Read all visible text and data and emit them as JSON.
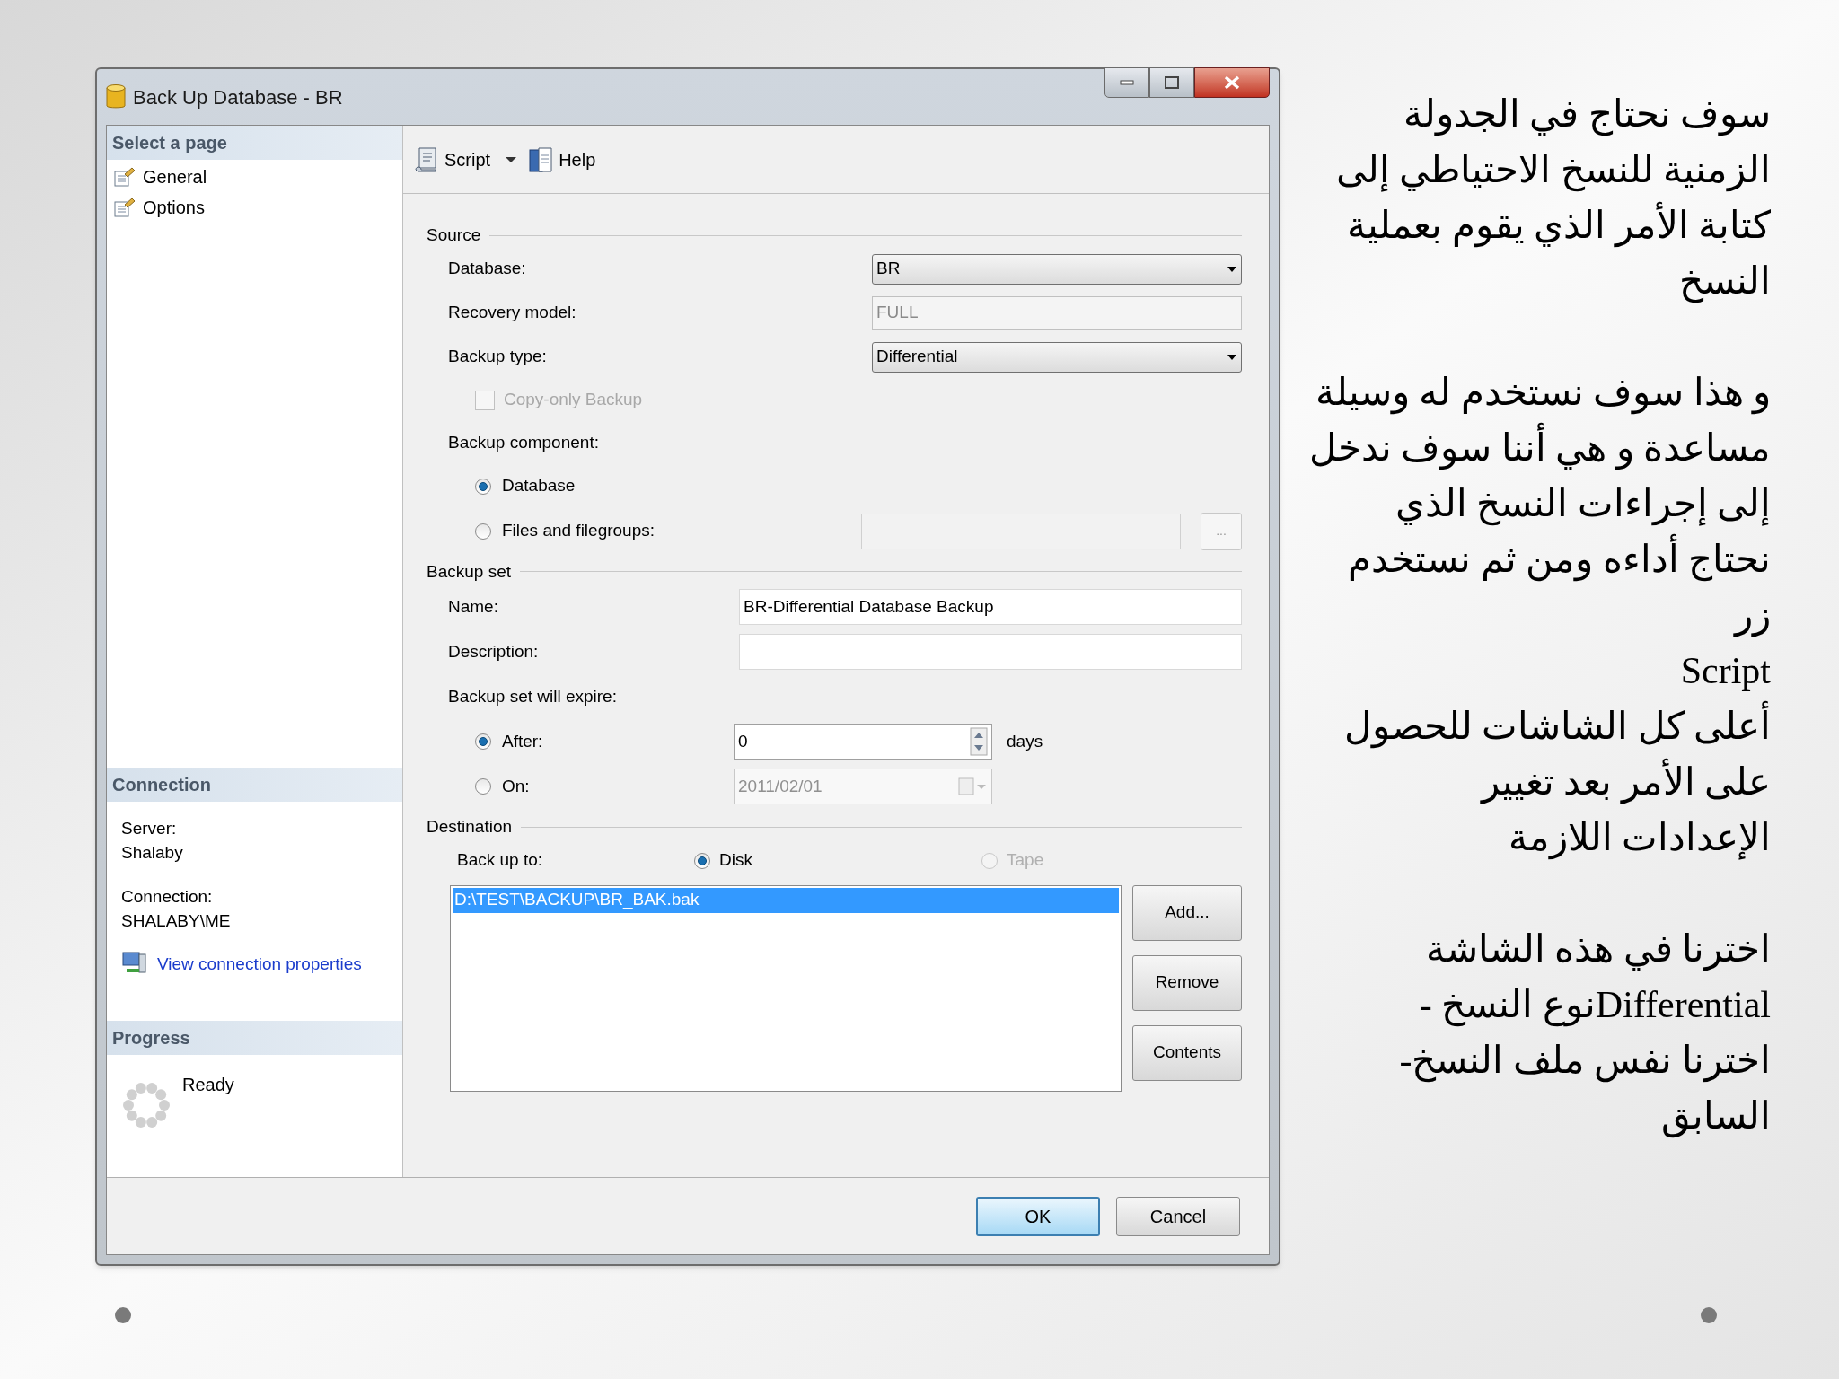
{
  "dialog": {
    "title": "Back Up Database - BR",
    "select_page": {
      "heading": "Select a page",
      "items": [
        {
          "label": "General",
          "selected": false
        },
        {
          "label": "Options",
          "selected": false
        }
      ]
    },
    "connection": {
      "heading": "Connection",
      "server_label": "Server:",
      "server": "Shalaby",
      "connection_label": "Connection:",
      "connection": "SHALABY\\ME",
      "link": "View connection properties"
    },
    "progress": {
      "heading": "Progress",
      "status": "Ready"
    },
    "toolbar": [
      {
        "label": "Script",
        "kind": "dropdown"
      },
      {
        "label": "Help",
        "kind": "help"
      }
    ],
    "source": {
      "heading": "Source",
      "database": {
        "label": "Database:",
        "value": "BR"
      },
      "recovery_model": {
        "label": "Recovery model:",
        "value": "FULL"
      },
      "backup_type": {
        "label": "Backup type:",
        "value": "Differential"
      },
      "copy_only": {
        "label": "Copy-only Backup",
        "checked": false,
        "disabled": true
      },
      "component": {
        "label": "Backup component:",
        "options": [
          {
            "label": "Database",
            "selected": true
          },
          {
            "label": "Files and filegroups:",
            "selected": false
          }
        ],
        "browse": "..."
      }
    },
    "backup_set": {
      "heading": "Backup set",
      "name": {
        "label": "Name:",
        "value": "BR-Differential Database Backup"
      },
      "description": {
        "label": "Description:"
      },
      "expire": {
        "label": "Backup set will expire:",
        "options": [
          {
            "label": "After:",
            "selected": true,
            "value": "0",
            "unit": "days"
          },
          {
            "label": "On:",
            "selected": false,
            "value": "2011/02/01"
          }
        ]
      }
    },
    "destination": {
      "heading": "Destination",
      "label": "Back up to:",
      "options": [
        {
          "label": "Disk",
          "selected": true,
          "disabled": false
        },
        {
          "label": "Tape",
          "selected": false,
          "disabled": true
        }
      ],
      "files": [
        {
          "path": "D:\\TEST\\BACKUP\\BR_BAK.bak",
          "selected": true
        }
      ],
      "buttons": [
        "Add...",
        "Remove",
        "Contents"
      ]
    },
    "footer_buttons": [
      {
        "label": "OK",
        "kind": "default"
      },
      {
        "label": "Cancel",
        "kind": "normal"
      }
    ]
  },
  "slide_text": [
    [
      "سوف نحتاج في الجدولة",
      "الزمنية للنسخ الاحتياطي إلى",
      "كتابة الأمر  الذي يقوم بعملية",
      "النسخ"
    ],
    [
      "و هذا سوف نستخدم له وسيلة",
      "مساعدة و هي أننا سوف ندخل",
      "إلى إجراءات النسخ الذي",
      "نحتاج أداءه ومن ثم نستخدم",
      "زر",
      "Script",
      "أعلى كل الشاشات للحصول",
      "على الأمر بعد تغيير",
      "الإعدادات اللازمة"
    ],
    [
      "اخترنا في هذه الشاشة",
      "Differentialنوع النسخ -",
      "اخترنا نفس ملف النسخ-",
      "السابق"
    ]
  ]
}
